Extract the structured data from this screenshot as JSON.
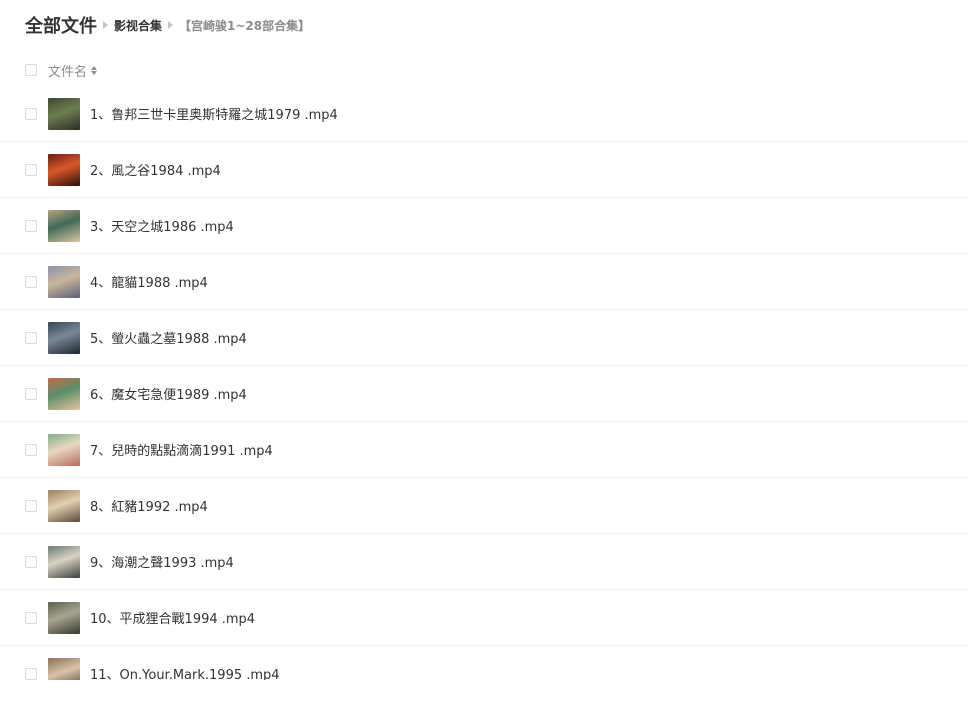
{
  "breadcrumb": {
    "root": "全部文件",
    "folder": "影视合集",
    "current": "【宫崎骏1~28部合集】"
  },
  "list_header": {
    "name_column": "文件名"
  },
  "files": [
    {
      "name": "1、鲁邦三世卡里奥斯特羅之城1979 .mp4",
      "thumb_colors": [
        "#3c4a32",
        "#6f7d52",
        "#2a2f26"
      ]
    },
    {
      "name": "2、風之谷1984 .mp4",
      "thumb_colors": [
        "#6b1e12",
        "#d8582a",
        "#2b0f0a"
      ]
    },
    {
      "name": "3、天空之城1986 .mp4",
      "thumb_colors": [
        "#b9a27c",
        "#3f6a58",
        "#d8c6a2"
      ]
    },
    {
      "name": "4、龍貓1988 .mp4",
      "thumb_colors": [
        "#8b93a8",
        "#c8b79c",
        "#5a6076"
      ]
    },
    {
      "name": "5、螢火蟲之墓1988 .mp4",
      "thumb_colors": [
        "#3a4656",
        "#7a8798",
        "#1f2630"
      ]
    },
    {
      "name": "6、魔女宅急便1989 .mp4",
      "thumb_colors": [
        "#c56a4a",
        "#5b8f6a",
        "#e4c39c"
      ]
    },
    {
      "name": "7、兒時的點點滴滴1991 .mp4",
      "thumb_colors": [
        "#7fae85",
        "#e7d7c2",
        "#b96c5e"
      ]
    },
    {
      "name": "8、紅豬1992 .mp4",
      "thumb_colors": [
        "#9c7f5e",
        "#e2cfb2",
        "#5d4a38"
      ]
    },
    {
      "name": "9、海潮之聲1993 .mp4",
      "thumb_colors": [
        "#6c7a72",
        "#d7d2c4",
        "#3b3f3a"
      ]
    },
    {
      "name": "10、平成狸合戰1994 .mp4",
      "thumb_colors": [
        "#5b6052",
        "#a8a58f",
        "#34382f"
      ]
    },
    {
      "name": "11、On.Your.Mark.1995 .mp4",
      "thumb_colors": [
        "#8a6f58",
        "#d9c2a6",
        "#4e3d31"
      ]
    }
  ]
}
